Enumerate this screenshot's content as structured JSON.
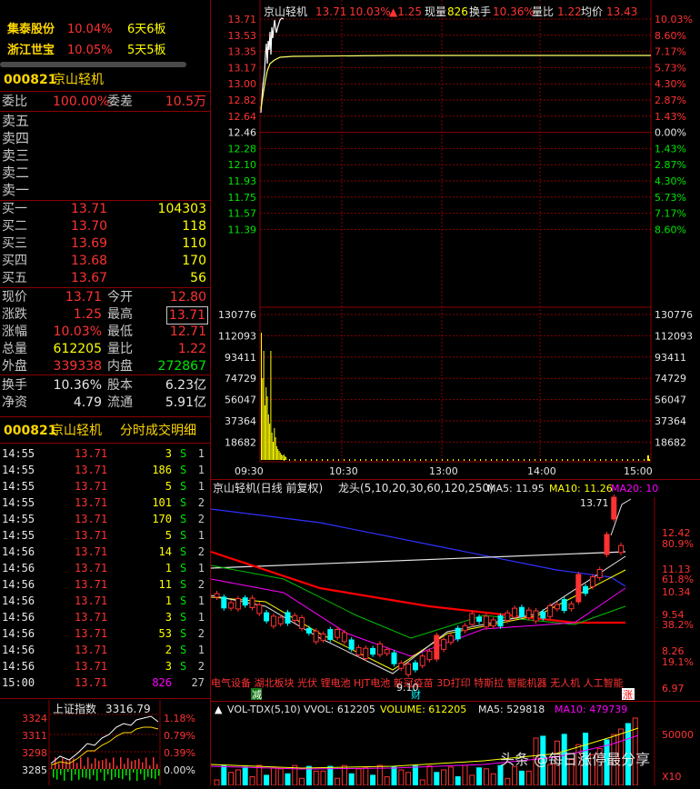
{
  "hot": [
    {
      "name": "集泰股份",
      "pct": "10.04%",
      "board": "6天6板"
    },
    {
      "name": "浙江世宝",
      "pct": "10.05%",
      "board": "5天5板"
    }
  ],
  "stock": {
    "code": "000821",
    "name": "京山轻机"
  },
  "weibi": {
    "label1": "委比",
    "value1": "100.00%",
    "label2": "委差",
    "value2": "10.5万"
  },
  "sells": [
    {
      "label": "卖五",
      "price": "",
      "vol": ""
    },
    {
      "label": "卖四",
      "price": "",
      "vol": ""
    },
    {
      "label": "卖三",
      "price": "",
      "vol": ""
    },
    {
      "label": "卖二",
      "price": "",
      "vol": ""
    },
    {
      "label": "卖一",
      "price": "",
      "vol": ""
    }
  ],
  "buys": [
    {
      "label": "买一",
      "price": "13.71",
      "vol": "104303"
    },
    {
      "label": "买二",
      "price": "13.70",
      "vol": "118"
    },
    {
      "label": "买三",
      "price": "13.69",
      "vol": "110"
    },
    {
      "label": "买四",
      "price": "13.68",
      "vol": "170"
    },
    {
      "label": "买五",
      "price": "13.67",
      "vol": "56"
    }
  ],
  "quote": [
    {
      "l1": "现价",
      "v1": "13.71",
      "c1": "red",
      "l2": "今开",
      "v2": "12.80",
      "c2": "red"
    },
    {
      "l1": "涨跌",
      "v1": "1.25",
      "c1": "red",
      "l2": "最高",
      "v2": "13.71",
      "c2": "red"
    },
    {
      "l1": "涨幅",
      "v1": "10.03%",
      "c1": "red",
      "l2": "最低",
      "v2": "12.71",
      "c2": "red"
    },
    {
      "l1": "总量",
      "v1": "612205",
      "c1": "yellow",
      "l2": "量比",
      "v2": "1.22",
      "c2": "red"
    },
    {
      "l1": "外盘",
      "v1": "339338",
      "c1": "red",
      "l2": "内盘",
      "v2": "272867",
      "c2": "green"
    }
  ],
  "quote2": [
    {
      "l1": "换手",
      "v1": "10.36%",
      "l2": "股本",
      "v2": "6.23亿"
    },
    {
      "l1": "净资",
      "v1": "4.79",
      "l2": "流通",
      "v2": "5.91亿"
    }
  ],
  "ticks_header": {
    "code": "000821",
    "name": "京山轻机",
    "title": "分时成交明细"
  },
  "ticks": [
    {
      "t": "14:55",
      "p": "13.71",
      "v": "3",
      "bs": "S",
      "n": "1"
    },
    {
      "t": "14:55",
      "p": "13.71",
      "v": "186",
      "bs": "S",
      "n": "1"
    },
    {
      "t": "14:55",
      "p": "13.71",
      "v": "5",
      "bs": "S",
      "n": "1"
    },
    {
      "t": "14:55",
      "p": "13.71",
      "v": "101",
      "bs": "S",
      "n": "2"
    },
    {
      "t": "14:55",
      "p": "13.71",
      "v": "170",
      "bs": "S",
      "n": "2"
    },
    {
      "t": "14:55",
      "p": "13.71",
      "v": "5",
      "bs": "S",
      "n": "1"
    },
    {
      "t": "14:56",
      "p": "13.71",
      "v": "14",
      "bs": "S",
      "n": "2"
    },
    {
      "t": "14:56",
      "p": "13.71",
      "v": "1",
      "bs": "S",
      "n": "1"
    },
    {
      "t": "14:56",
      "p": "13.71",
      "v": "11",
      "bs": "S",
      "n": "2"
    },
    {
      "t": "14:56",
      "p": "13.71",
      "v": "1",
      "bs": "S",
      "n": "1"
    },
    {
      "t": "14:56",
      "p": "13.71",
      "v": "3",
      "bs": "S",
      "n": "1"
    },
    {
      "t": "14:56",
      "p": "13.71",
      "v": "53",
      "bs": "S",
      "n": "2"
    },
    {
      "t": "14:56",
      "p": "13.71",
      "v": "2",
      "bs": "S",
      "n": "1"
    },
    {
      "t": "14:56",
      "p": "13.71",
      "v": "3",
      "bs": "S",
      "n": "2"
    },
    {
      "t": "15:00",
      "p": "13.71",
      "v": "826",
      "bs": "",
      "n": "27"
    }
  ],
  "index": {
    "name": "上证指数",
    "value": "3316.79",
    "ylabels": [
      "3324",
      "3311",
      "3298",
      "3285"
    ],
    "pct": [
      "1.18%",
      "0.79%",
      "0.39%",
      "0.00%"
    ]
  },
  "intraday": {
    "header": {
      "name": "京山轻机",
      "price": "13.71",
      "pct": "10.03%",
      "chg": "▲1.25",
      "cur_vol_label": "现量",
      "cur_vol": "826",
      "turn_label": "换手",
      "turn": "10.36%",
      "lb_label": "量比",
      "lb": "1.22",
      "avg_label": "均价",
      "avg": "13.43"
    },
    "price_left": [
      "13.71",
      "13.53",
      "13.35",
      "13.17",
      "13.00",
      "12.82",
      "12.64",
      "12.46",
      "12.28",
      "12.10",
      "11.93",
      "11.75",
      "11.57",
      "11.39"
    ],
    "pct_right": [
      "10.03%",
      "8.60%",
      "7.17%",
      "5.73%",
      "4.30%",
      "2.87%",
      "1.43%",
      "0.00%",
      "1.43%",
      "2.87%",
      "4.30%",
      "5.73%",
      "7.17%",
      "8.60%"
    ],
    "vol_labels": [
      "130776",
      "112093",
      "93411",
      "74729",
      "56047",
      "37364",
      "18682"
    ],
    "times": [
      "09:30",
      "10:30",
      "13:00",
      "14:00",
      "15:00"
    ]
  },
  "kline": {
    "title": "京山轻机(日线 前复权)",
    "indicator": "龙头(5,10,20,30,60,120,250)",
    "ma5": "MA5: 11.95",
    "ma10": "MA10: 11.26",
    "ma20": "MA20: 10",
    "high_label": "13.71",
    "right_labels": [
      "12.42",
      "80.9%",
      "11.13",
      "61.8%",
      "10.34",
      "9.54",
      "38.2%",
      "8.26",
      "19.1%",
      "6.97"
    ],
    "tags": "电气设备 湖北板块 光伏 锂电池 HJT电池 新冠疫苗 3D打印 特斯拉 智能机器 无人机 人工智能",
    "marks": {
      "jian": "减",
      "cai": "财",
      "zhang": "涨"
    },
    "low_label": "9.10"
  },
  "vol": {
    "label": "VOL-TDX(5,10)",
    "vvol": "VVOL: 612205",
    "volume": "VOLUME: 612205",
    "ma5": "MA5: 529818",
    "ma10": "MA10: 479739",
    "right_labels": [
      "50000",
      "X10"
    ]
  },
  "watermark": "头条 @每日涨停最分享"
}
